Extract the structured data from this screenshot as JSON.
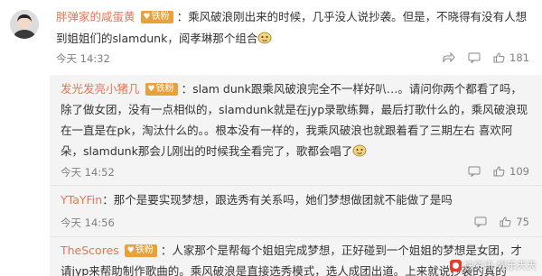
{
  "comment": {
    "username": "胖弹家的咸蛋黄",
    "badge": "铁粉",
    "text": "：乘风破浪刚出来的时候，几乎没人说抄袭。但是，不晓得有没有人想到姐姐们的slamdunk，阅孝琳那个组合",
    "emoji": "doge-face",
    "time": "今天 14:32",
    "likes": "181"
  },
  "replies": [
    {
      "username": "发光发亮小猪几",
      "badge": "铁粉",
      "text": "：slam dunk跟乘风破浪完全不一样好叭…。请问你两个都看了吗，除了做女团，没有一点相似的，slamdunk就是在jyp录歌练舞，最后打歌什么的，乘风破浪现在一直是在pk，淘汰什么的。。根本没有一样的，我乘风破浪也就跟着看了三期左右 喜欢阿朵，slamdunk那会儿刚出的时候我全看完了，歌都会唱了",
      "emoji": "doge-face",
      "time": "今天 14:52",
      "likes": "109"
    },
    {
      "username": "YTaYFin",
      "text": "：那个是要实现梦想，跟选秀有关系吗，她们梦想做团就不能做了是吗",
      "time": "今天 14:56",
      "likes": "75"
    },
    {
      "username": "TheScores",
      "badge": "铁粉",
      "text": "：人家那个是帮每个姐姐完成梦想，正好碰到一个姐姐的梦想是女团，才请jyp来帮助制作歌曲的。乘风破浪是直接选秀模式，选人成团出道。上来就说抄袭的真的",
      "time": "",
      "likes": ""
    }
  ],
  "icons": {
    "share": "share-icon",
    "comment": "comment-icon",
    "like": "thumbs-up-icon"
  },
  "watermark": "快资讯·娱乐天天"
}
